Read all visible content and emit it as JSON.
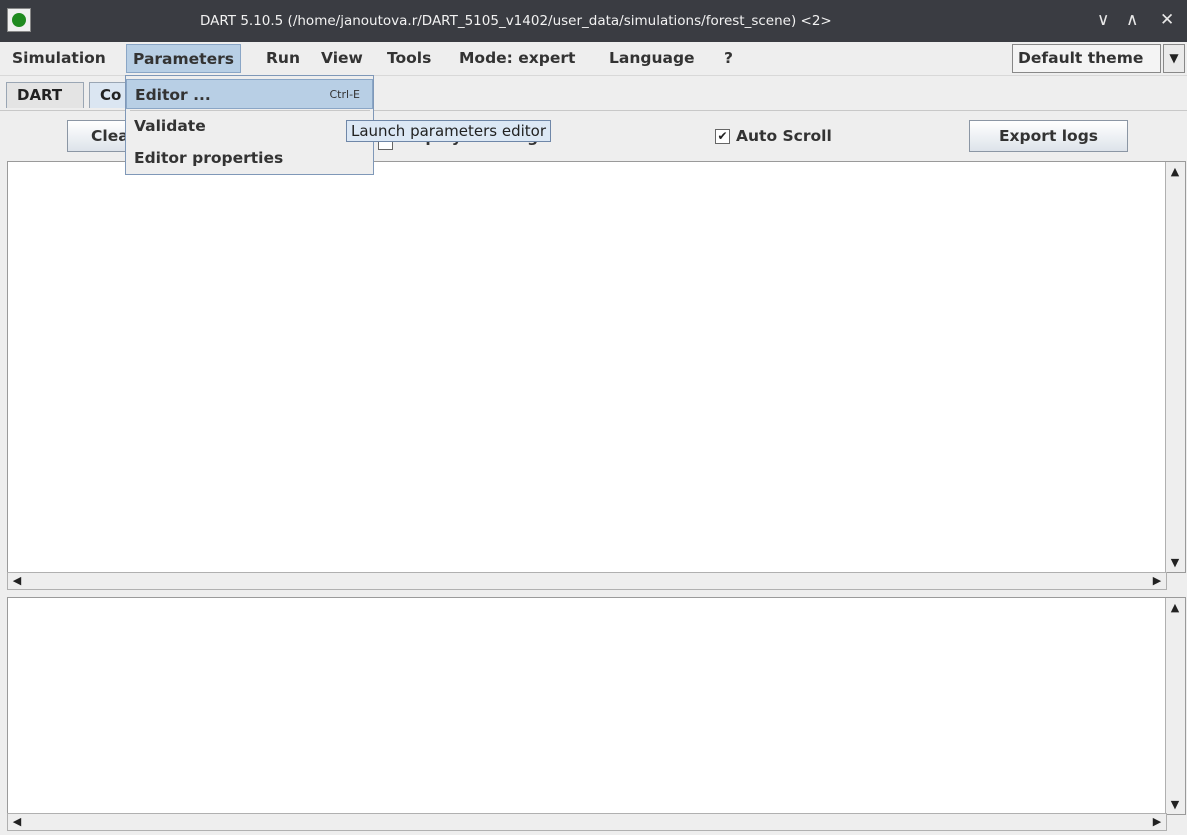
{
  "window": {
    "title": "DART 5.10.5 (/home/janoutova.r/DART_5105_v1402/user_data/simulations/forest_scene) <2>",
    "minimize": "∨",
    "maximize": "∧",
    "close": "✕"
  },
  "menubar": {
    "items": [
      "Simulation",
      "Parameters",
      "Run",
      "View",
      "Tools",
      "Mode: expert",
      "Language",
      "?"
    ],
    "active_index": 1,
    "theme": "Default theme",
    "theme_arrow": "▼"
  },
  "tabs": [
    {
      "label": "DART",
      "selected": false
    },
    {
      "label": "Co",
      "selected": true
    }
  ],
  "toolbar": {
    "clear_label": "Clea",
    "display_checkbox_label": "Display warnings",
    "autoscroll_label": "Auto Scroll",
    "autoscroll_checked": true,
    "autoscroll_mark": "✔",
    "export_label": "Export logs"
  },
  "dropdown": {
    "items": [
      {
        "label": "Editor ...",
        "shortcut": "Ctrl-E",
        "highlighted": true
      },
      {
        "label": "Validate",
        "shortcut": "",
        "highlighted": false
      },
      {
        "label": "Editor properties",
        "shortcut": "",
        "highlighted": false
      }
    ]
  },
  "tooltip": "Launch parameters editor",
  "scroll_arrows": {
    "up": "▲",
    "down": "▼",
    "left": "◀",
    "right": "▶"
  },
  "colors": {
    "titlebar": "#3a3c42",
    "menu_highlight": "#b8cfe5",
    "tooltip_bg": "#dce8f5",
    "app_icon_dot": "#1f8a1f"
  }
}
